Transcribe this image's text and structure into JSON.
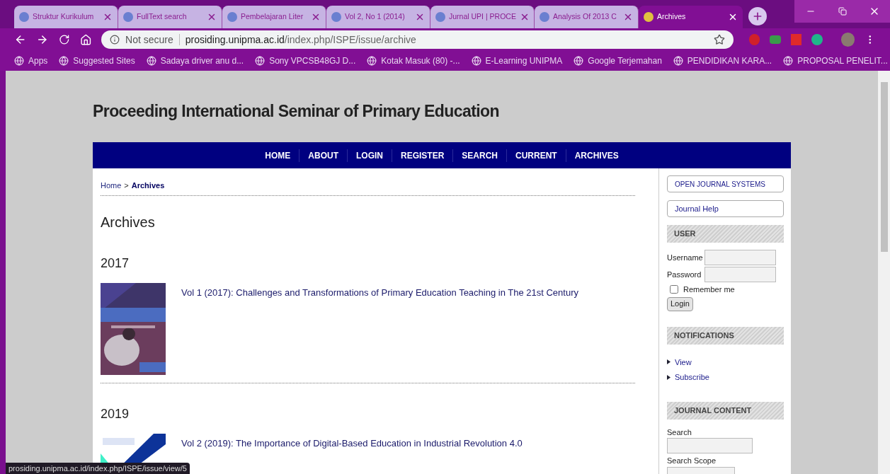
{
  "browser": {
    "tabs": [
      {
        "title": "Struktur Kurikulum",
        "selected": false
      },
      {
        "title": "FullText search",
        "selected": false
      },
      {
        "title": "Pembelajaran Liter",
        "selected": false
      },
      {
        "title": "Vol 2, No 1 (2014)",
        "selected": false
      },
      {
        "title": "Jurnal UPI | PROCE",
        "selected": false
      },
      {
        "title": "Analysis Of 2013 C",
        "selected": false
      },
      {
        "title": "Archives",
        "selected": true
      }
    ],
    "address": {
      "security": "Not secure",
      "domain": "prosiding.unipma.ac.id",
      "path": "/index.php/ISPE/issue/archive"
    },
    "bookmarks": [
      "Apps",
      "Suggested Sites",
      "Sadaya driver anu d...",
      "Sony VPCSB48GJ D...",
      "Kotak Masuk (80) -...",
      "E-Learning UNIPMA",
      "Google Terjemahan",
      "PENDIDIKAN KARA...",
      "PROPOSAL PENELIT..."
    ]
  },
  "site": {
    "title": "Proceeding International Seminar of Primary Education",
    "nav": [
      "HOME",
      "ABOUT",
      "LOGIN",
      "REGISTER",
      "SEARCH",
      "CURRENT",
      "ARCHIVES"
    ],
    "breadcrumb": [
      {
        "label": "Home",
        "selected": false
      },
      {
        "label": "Archives",
        "selected": true
      }
    ],
    "breadcrumb_separator": ">",
    "heading": "Archives",
    "years": [
      {
        "year": "2017",
        "issues": [
          {
            "title": "Vol 1 (2017): Challenges and Transformations of Primary Education Teaching in The 21st Century"
          }
        ]
      },
      {
        "year": "2019",
        "issues": [
          {
            "title": "Vol 2 (2019): The Importance of Digital-Based Education in Industrial Revolution 4.0"
          }
        ]
      }
    ]
  },
  "sidebar": {
    "buttons": [
      "OPEN JOURNAL SYSTEMS",
      "Journal Help"
    ],
    "user": {
      "title": "USER",
      "fields": [
        "Username",
        "Password"
      ],
      "remember": {
        "label": "Remember me",
        "checked": false
      },
      "login": "Login"
    },
    "notifications": {
      "title": "NOTIFICATIONS",
      "links": [
        "View",
        "Subscribe"
      ]
    },
    "journal_content": {
      "title": "JOURNAL CONTENT",
      "search_label": "Search",
      "scope_label": "Search Scope"
    }
  },
  "status_url": "prosiding.unipma.ac.id/index.php/ISPE/issue/view/5"
}
